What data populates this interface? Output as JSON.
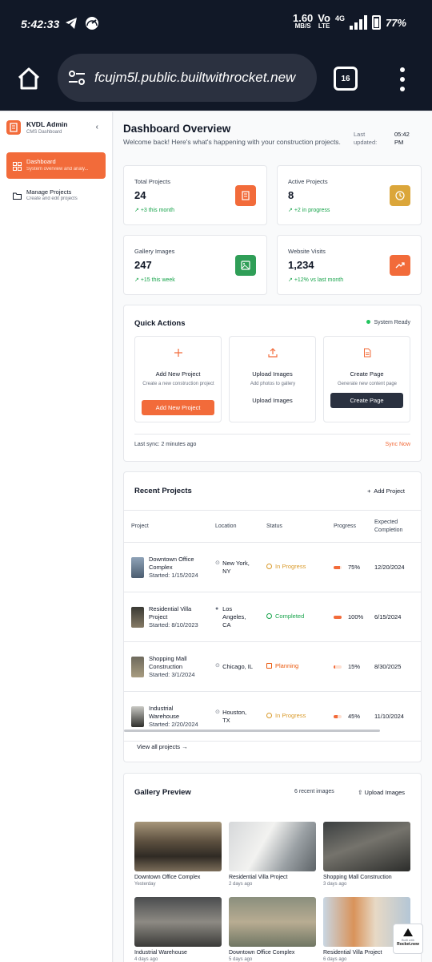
{
  "status_bar": {
    "time": "5:42:33",
    "speed_value": "1.60",
    "speed_unit": "MB/S",
    "volte_top": "Vo",
    "volte_bottom": "LTE",
    "network": "4G",
    "battery": "77%"
  },
  "browser": {
    "url": "fcujm5l.public.builtwithrocket.new",
    "tab_count": "16"
  },
  "sidebar": {
    "brand_name": "KVDL Admin",
    "brand_sub": "CMS Dashboard",
    "collapse_icon": "‹",
    "items": [
      {
        "label": "Dashboard",
        "sub": "System overview and analy..."
      },
      {
        "label": "Manage Projects",
        "sub": "Create and edit projects"
      }
    ]
  },
  "header": {
    "title": "Dashboard Overview",
    "subtitle": "Welcome back! Here's what's happening with your construction projects.",
    "last_updated_label": "Last updated:",
    "last_updated_time": "05:42 PM"
  },
  "stats": [
    {
      "label": "Total Projects",
      "value": "24",
      "trend": "+3 this month",
      "color": "#f26b3a"
    },
    {
      "label": "Active Projects",
      "value": "8",
      "trend": "+2 in progress",
      "color": "#dba63a"
    },
    {
      "label": "Gallery Images",
      "value": "247",
      "trend": "+15 this week",
      "color": "#2f9e57"
    },
    {
      "label": "Website Visits",
      "value": "1,234",
      "trend": "+12% vs last month",
      "color": "#f26b3a"
    }
  ],
  "quick_actions": {
    "title": "Quick Actions",
    "system_status": "System Ready",
    "actions": [
      {
        "title": "Add New Project",
        "desc": "Create a new construction project",
        "button": "Add New Project"
      },
      {
        "title": "Upload Images",
        "desc": "Add photos to gallery",
        "button": "Upload Images"
      },
      {
        "title": "Create Page",
        "desc": "Generate new content page",
        "button": "Create Page"
      }
    ],
    "last_sync": "Last sync: 2 minutes ago",
    "sync_now": "Sync Now"
  },
  "recent_projects": {
    "title": "Recent Projects",
    "add_label": "Add Project",
    "columns": [
      "Project",
      "Location",
      "Status",
      "Progress",
      "Expected Completion"
    ],
    "rows": [
      {
        "name": "Downtown Office Complex",
        "started": "Started: 1/15/2024",
        "location": "New York, NY",
        "status": "In Progress",
        "progress": 75,
        "progress_label": "75%",
        "completion": "12/20/2024"
      },
      {
        "name": "Residential Villa Project",
        "started": "Started: 8/10/2023",
        "location": "Los Angeles, CA",
        "status": "Completed",
        "progress": 100,
        "progress_label": "100%",
        "completion": "6/15/2024"
      },
      {
        "name": "Shopping Mall Construction",
        "started": "Started: 3/1/2024",
        "location": "Chicago, IL",
        "status": "Planning",
        "progress": 15,
        "progress_label": "15%",
        "completion": "8/30/2025"
      },
      {
        "name": "Industrial Warehouse",
        "started": "Started: 2/20/2024",
        "location": "Houston, TX",
        "status": "In Progress",
        "progress": 45,
        "progress_label": "45%",
        "completion": "11/10/2024"
      }
    ],
    "view_all": "View all projects"
  },
  "gallery": {
    "title": "Gallery Preview",
    "count_label": "6 recent images",
    "upload_label": "Upload Images",
    "items": [
      {
        "title": "Downtown Office Complex",
        "date": "Yesterday"
      },
      {
        "title": "Residential Villa Project",
        "date": "2 days ago"
      },
      {
        "title": "Shopping Mall Construction",
        "date": "3 days ago"
      },
      {
        "title": "Industrial Warehouse",
        "date": "4 days ago"
      },
      {
        "title": "Downtown Office Complex",
        "date": "5 days ago"
      },
      {
        "title": "Residential Villa Project",
        "date": "6 days ago"
      }
    ]
  },
  "badge": {
    "line1": "Built with",
    "line2": "Rocket.new"
  }
}
